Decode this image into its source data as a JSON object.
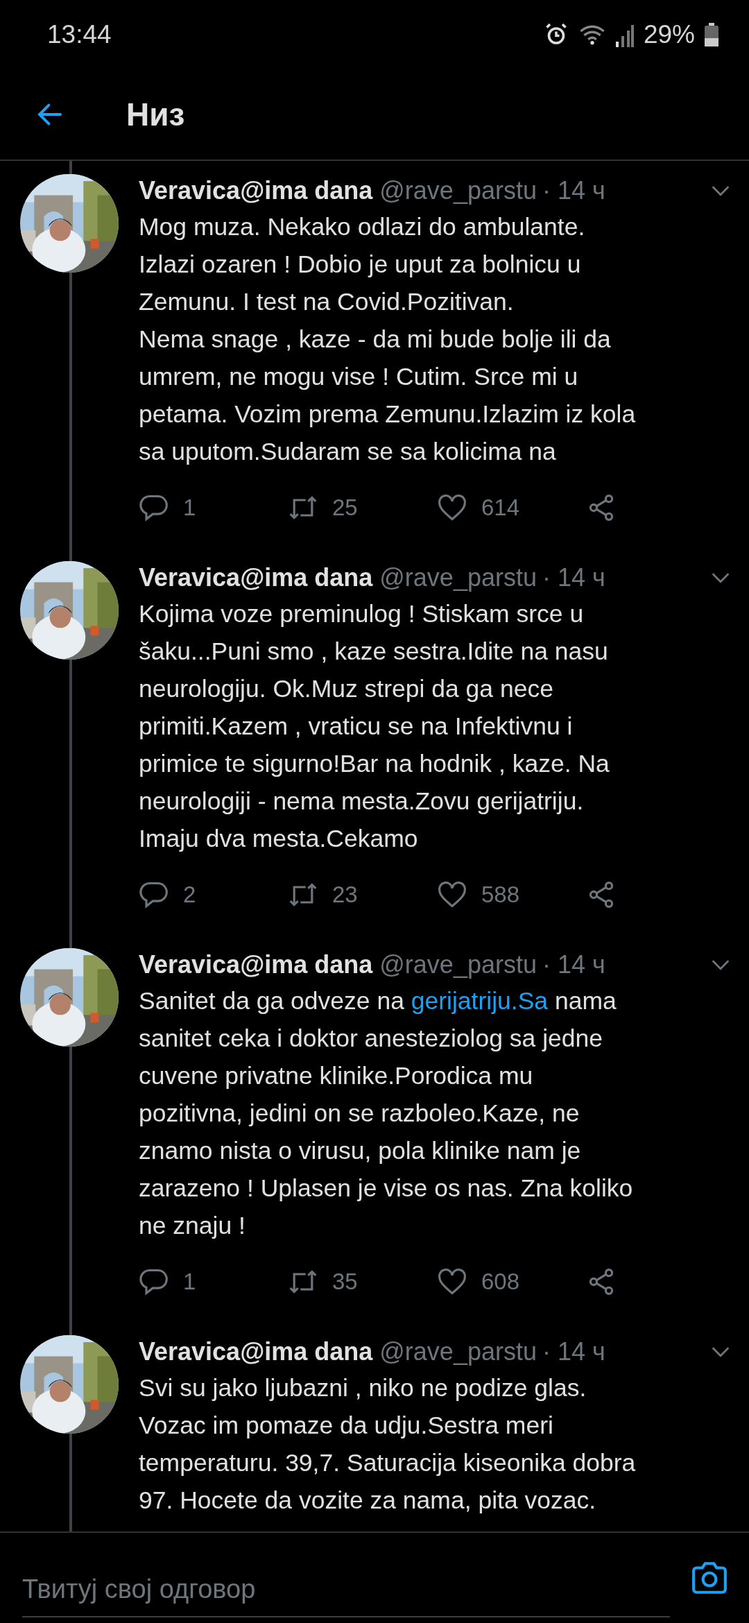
{
  "status_bar": {
    "time": "13:44",
    "battery": "29%"
  },
  "header": {
    "title": "Низ"
  },
  "tweets": [
    {
      "name": "Veravica@ima dana",
      "handle": "@rave_parstu",
      "time": "· 14 ч",
      "parts": [
        {
          "text": "Mog muza. Nekako odlazi do ambulante.\nIzlazi ozaren ! Dobio je uput za bolnicu u\nZemunu. I test na Covid.Pozitivan.\nNema snage , kaze - da mi bude bolje ili da\numrem, ne mogu vise ! Cutim. Srce mi u\npetama. Vozim prema Zemunu.Izlazim iz kola\nsa uputom.Sudaram se sa kolicima na"
        }
      ],
      "actions": {
        "replies": "1",
        "retweets": "25",
        "likes": "614"
      }
    },
    {
      "name": "Veravica@ima dana",
      "handle": "@rave_parstu",
      "time": "· 14 ч",
      "parts": [
        {
          "text": "Kojima voze preminulog ! Stiskam srce u\nšaku...Puni smo , kaze sestra.Idite na nasu\nneurologiju. Ok.Muz strepi da ga nece\nprimiti.Kazem , vraticu se na Infektivnu i\nprimice te sigurno!Bar na hodnik , kaze. Na\nneurologiji - nema mesta.Zovu gerijatriju.\nImaju dva mesta.Cekamo"
        }
      ],
      "actions": {
        "replies": "2",
        "retweets": "23",
        "likes": "588"
      }
    },
    {
      "name": "Veravica@ima dana",
      "handle": "@rave_parstu",
      "time": "· 14 ч",
      "parts": [
        {
          "text": "Sanitet da ga odveze na "
        },
        {
          "text": "gerijatriju.Sa",
          "kind": "link"
        },
        {
          "text": " nama\nsanitet ceka i doktor anesteziolog sa jedne\ncuvene privatne klinike.Porodica mu\npozitivna, jedini on se razboleo.Kaze, ne\nznamo nista o virusu, pola klinike nam je\nzarazeno ! Uplasen je vise os nas. Zna koliko\nne znaju !"
        }
      ],
      "actions": {
        "replies": "1",
        "retweets": "35",
        "likes": "608"
      }
    },
    {
      "name": "Veravica@ima dana",
      "handle": "@rave_parstu",
      "time": "· 14 ч",
      "parts": [
        {
          "text": "Svi su jako ljubazni , niko ne podize glas.\nVozac im pomaze da udju.Sestra meri\ntemperaturu. 39,7. Saturacija kiseonika dobra\n97. Hocete da vozite za nama, pita vozac."
        }
      ]
    }
  ],
  "reply_bar": {
    "placeholder": "Твитуј свој одговор"
  }
}
